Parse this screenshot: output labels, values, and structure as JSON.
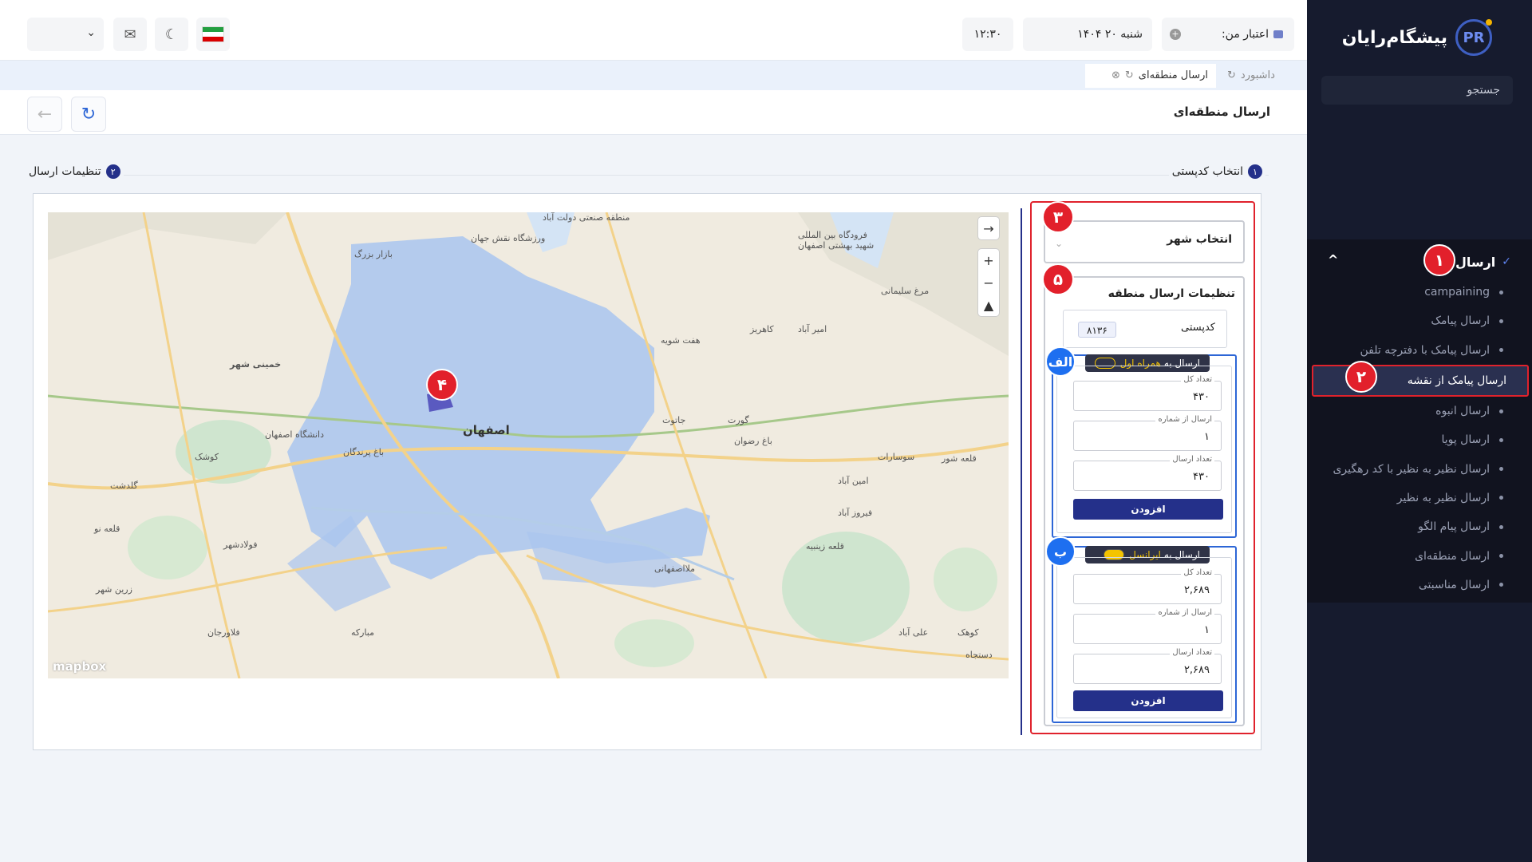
{
  "brand": {
    "name": "پیشگام‌رایان",
    "logo_text": "PR"
  },
  "sidebar": {
    "search_label": "جستجو",
    "group_label": "ارسال",
    "items": [
      {
        "label": "campaining"
      },
      {
        "label": "ارسال پیامک"
      },
      {
        "label": "ارسال پیامک با دفترچه تلفن"
      },
      {
        "label": "ارسال پیامک از نقشه",
        "active": true
      },
      {
        "label": "ارسال انبوه"
      },
      {
        "label": "ارسال پویا"
      },
      {
        "label": "ارسال نظیر به نظیر با کد رهگیری"
      },
      {
        "label": "ارسال نظیر به نظیر"
      },
      {
        "label": "ارسال پیام الگو"
      },
      {
        "label": "ارسال منطقه‌ای"
      },
      {
        "label": "ارسال مناسبتی"
      }
    ]
  },
  "badges": {
    "b1": "۱",
    "b2": "۲",
    "b3": "۳",
    "b4": "۴",
    "b5": "۵",
    "ba": "الف",
    "bb": "ب"
  },
  "topbar": {
    "credit_label": "اعتبار من:",
    "date": "شنبه ۲۰ ۱۴۰۴",
    "time": "۱۲:۳۰"
  },
  "tabs": [
    {
      "label": "داشبورد"
    },
    {
      "label": "ارسال منطقه‌ای",
      "active": true
    }
  ],
  "page": {
    "title": "ارسال منطقه‌ای"
  },
  "steps": [
    {
      "num": "۱",
      "label": "انتخاب کدپستی"
    },
    {
      "num": "۲",
      "label": "تنظیمات ارسال"
    }
  ],
  "map": {
    "city_label": "اصفهان",
    "labels": {
      "l1": "خمینی شهر",
      "l2": "فولادشهر",
      "l3": "کوشک",
      "l4": "گلدشت",
      "l5": "قلعه نو",
      "l6": "فلاورجان",
      "l7": "زرین شهر",
      "l8": "مرغ سلیمانی",
      "l9": "فرودگاه بین المللی شهید بهشتی اصفهان",
      "l10": "امیر آباد",
      "l11": "سوسارات",
      "l12": "قلعه شور",
      "l13": "امین آباد",
      "l14": "فیروز آباد",
      "l15": "قلعه زینبیه",
      "l16": "ملااصفهانی",
      "l17": "علی آباد",
      "l18": "کوهک",
      "l19": "منطقه صنعتی دولت آباد",
      "l20": "ورزشگاه نقش جهان",
      "l21": "بازار بزرگ",
      "l22": "باغ رضوان",
      "l23": "گورت",
      "l24": "مبارکه",
      "l25": "هفت شویه",
      "l26": "جاتوت",
      "l27": "کاهریز",
      "l28": "دستجاه",
      "l29": "دانشگاه اصفهان",
      "l30": "باغ پرندگان"
    },
    "mapbox_label": "mapbox"
  },
  "settings": {
    "city_select_label": "انتخاب شهر",
    "region_title": "تنظیمات ارسال منطقه",
    "postal_label": "کدپستی",
    "postal_value": "۸۱۳۶",
    "operators": [
      {
        "prefix": "ارسال به",
        "name": "همراه اول",
        "fields": [
          {
            "label": "تعداد کل",
            "value": "۴۳۰"
          },
          {
            "label": "ارسال از شماره",
            "value": "۱"
          },
          {
            "label": "تعداد ارسال",
            "value": "۴۳۰"
          }
        ],
        "button": "افزودن"
      },
      {
        "prefix": "ارسال به",
        "name": "ایرانسل",
        "fields": [
          {
            "label": "تعداد کل",
            "value": "۲,۶۸۹"
          },
          {
            "label": "ارسال از شماره",
            "value": "۱"
          },
          {
            "label": "تعداد ارسال",
            "value": "۲,۶۸۹"
          }
        ],
        "button": "افزودن"
      }
    ]
  },
  "colors": {
    "sidebar_bg": "#161b2e",
    "accent": "#24308a",
    "highlight": "#e0222c",
    "map_region": "#a9c5ee"
  }
}
